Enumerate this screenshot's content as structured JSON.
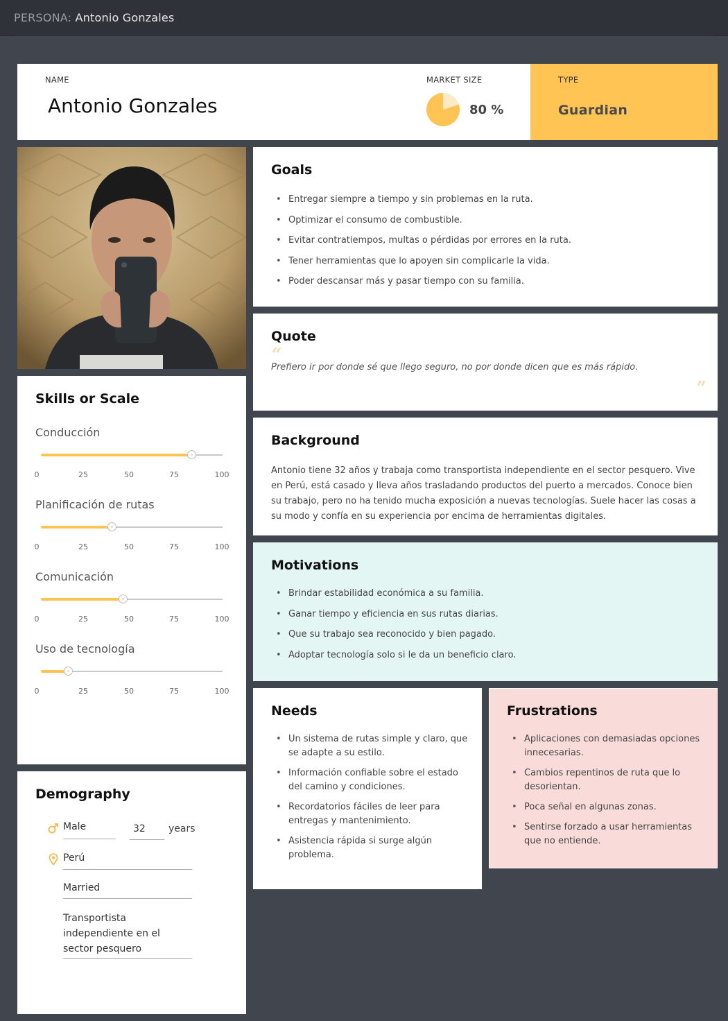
{
  "topbar": {
    "prefix": "PERSONA:",
    "name": "Antonio Gonzales"
  },
  "header": {
    "name_label": "NAME",
    "name": "Antonio Gonzales",
    "market_label": "MARKET SIZE",
    "market_value": "80 %",
    "market_fraction": 0.8,
    "type_label": "TYPE",
    "type_value": "Guardian"
  },
  "colors": {
    "accent": "#ffc453",
    "motivations_bg": "#e4f6f3",
    "frustrations_bg": "#f9dcd9",
    "background": "#41454d"
  },
  "goals": {
    "title": "Goals",
    "items": [
      "Entregar siempre a tiempo y sin problemas en la ruta.",
      "Optimizar el consumo de combustible.",
      "Evitar contratiempos, multas o pérdidas por errores en la ruta.",
      "Tener herramientas que lo apoyen sin complicarle la vida.",
      "Poder descansar más y pasar tiempo con su familia."
    ]
  },
  "quote": {
    "title": "Quote",
    "text": "Prefiero ir por donde sé que llego seguro, no por donde dicen que es más rápido."
  },
  "background": {
    "title": "Background",
    "text": "Antonio tiene 32 años y trabaja como transportista independiente en el sector pesquero. Vive en Perú, está casado y lleva años trasladando productos del puerto a mercados. Conoce bien su trabajo, pero no ha tenido mucha exposición a nuevas tecnologías. Suele hacer las cosas a su modo y confía en su experiencia por encima de herramientas digitales."
  },
  "motivations": {
    "title": "Motivations",
    "items": [
      "Brindar estabilidad económica a su familia.",
      "Ganar tiempo y eficiencia en sus rutas diarias.",
      "Que su trabajo sea reconocido y bien pagado.",
      "Adoptar tecnología solo si le da un beneficio claro."
    ]
  },
  "needs": {
    "title": "Needs",
    "items": [
      "Un sistema de rutas simple y claro, que se adapte a su estilo.",
      "Información confiable sobre el estado del camino y condiciones.",
      "Recordatorios fáciles de leer para entregas y mantenimiento.",
      "Asistencia rápida si surge algún problema."
    ]
  },
  "frustrations": {
    "title": "Frustrations",
    "items": [
      "Aplicaciones con demasiadas opciones innecesarias.",
      "Cambios repentinos de ruta que lo desorientan.",
      "Poca señal en algunas zonas.",
      "Sentirse forzado a usar herramientas que no entiende."
    ]
  },
  "skills": {
    "title": "Skills or Scale",
    "ticks": [
      "0",
      "25",
      "50",
      "75",
      "100"
    ],
    "items": [
      {
        "name": "Conducción",
        "value": 83
      },
      {
        "name": "Planificación de rutas",
        "value": 39
      },
      {
        "name": "Comunicación",
        "value": 45
      },
      {
        "name": "Uso de tecnología",
        "value": 15
      }
    ]
  },
  "demography": {
    "title": "Demography",
    "gender": "Male",
    "age": "32",
    "age_unit": "years",
    "location": "Perú",
    "status": "Married",
    "occupation": "Transportista independiente en el sector pesquero",
    "icons": {
      "gender": "male-icon",
      "location": "location-pin-icon"
    }
  }
}
